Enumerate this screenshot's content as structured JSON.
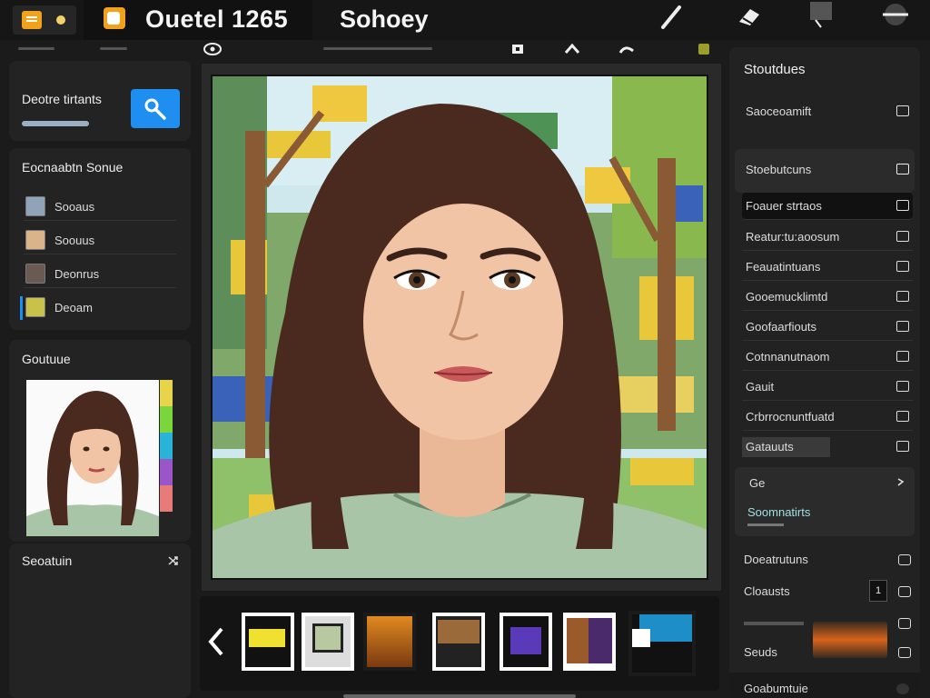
{
  "app": {
    "tab_title": "Ouetel 1265",
    "document_title": "Sohoey"
  },
  "toolbar": {
    "icons": [
      "pen-icon",
      "eraser-icon",
      "layer-icon",
      "menu-icon"
    ]
  },
  "left_panel": {
    "search": {
      "label": "Deotre tirtants"
    },
    "layers": {
      "title": "Eocnaabtn Sonue",
      "items": [
        {
          "label": "Sooaus"
        },
        {
          "label": "Soouus"
        },
        {
          "label": "Deonrus"
        },
        {
          "label": "Deoam"
        }
      ]
    },
    "preview": {
      "title": "Goutuue"
    },
    "footer": {
      "title": "Seoatuin"
    }
  },
  "right_panel": {
    "title": "Stoutdues",
    "header_row": "Saoceoamift",
    "group_row": "Stoebutcuns",
    "rows": [
      {
        "label": "Foauer strtaos"
      },
      {
        "label": "Reatur:tu:aoosum"
      },
      {
        "label": "Feauatintuans"
      },
      {
        "label": "Gooemucklimtd"
      },
      {
        "label": "Goofaarfiouts"
      },
      {
        "label": "Cotnnanutnaom"
      },
      {
        "label": "Gauit"
      },
      {
        "label": "Crbrrocnuntfuatd"
      },
      {
        "label": "Gatauuts"
      }
    ],
    "sub_section": {
      "title": "Ge",
      "value": "Soomnatirts"
    },
    "bottom_rows": [
      {
        "label": "Doeatrutuns"
      },
      {
        "label": "Cloausts",
        "badge": "1"
      },
      {
        "label": ""
      },
      {
        "label": "Seuds"
      }
    ],
    "footer": "Goabumtuie"
  },
  "colors": {
    "accent": "#1e8ef0",
    "app_icon": "#f2a11b",
    "panel": "#232323",
    "background": "#1b1b1b"
  }
}
